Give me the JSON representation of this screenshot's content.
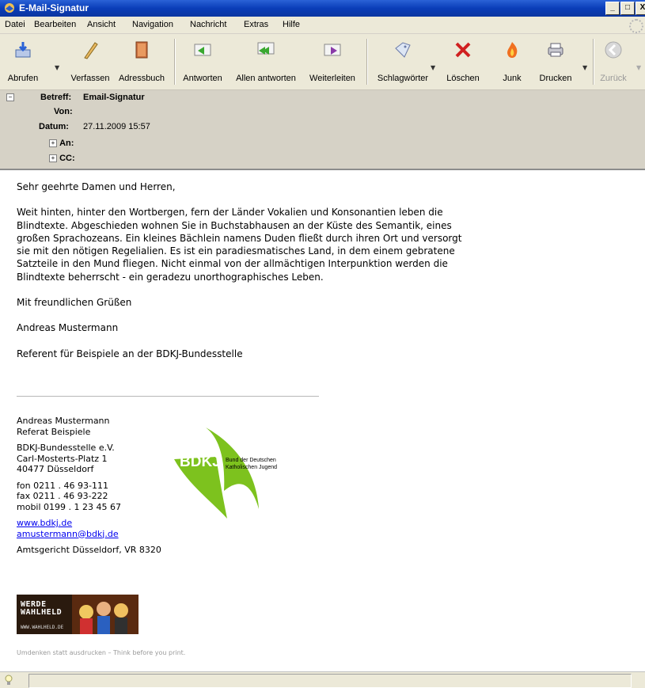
{
  "window": {
    "title": "E-Mail-Signatur",
    "buttons": [
      "_",
      "□",
      "X"
    ]
  },
  "menu": [
    "Datei",
    "Bearbeiten",
    "Ansicht",
    "Navigation",
    "Nachricht",
    "Extras",
    "Hilfe"
  ],
  "toolbar": {
    "abrufen": "Abrufen",
    "verfassen": "Verfassen",
    "adressbuch": "Adressbuch",
    "antworten": "Antworten",
    "allen_antworten": "Allen antworten",
    "weiterleiten": "Weiterleiten",
    "schlagwoerter": "Schlagwörter",
    "loeschen": "Löschen",
    "junk": "Junk",
    "drucken": "Drucken",
    "zurueck": "Zurück"
  },
  "header": {
    "collapse": "−",
    "betreff_label": "Betreff:",
    "betreff_value": "Email-Signatur",
    "von_label": "Von:",
    "von_value": "",
    "datum_label": "Datum:",
    "datum_value": "27.11.2009 15:57",
    "an_label": "An:",
    "cc_label": "CC:",
    "expand": "+"
  },
  "body": {
    "greeting": "Sehr geehrte Damen und Herren,",
    "paragraph": [
      "Weit hinten, hinter den Wortbergen, fern der Länder Vokalien und Konsonantien leben die",
      "Blindtexte. Abgeschieden wohnen Sie in Buchstabhausen an der Küste des Semantik, eines",
      "großen Sprachozeans. Ein kleines Bächlein namens Duden fließt durch ihren Ort und versorgt",
      "sie mit den nötigen Regelialien. Es ist ein paradiesmatisches Land, in dem einem gebratene",
      "Satzteile in den Mund fliegen. Nicht einmal von der allmächtigen Interpunktion werden die",
      "Blindtexte beherrscht - ein geradezu unorthographisches Leben."
    ],
    "closing": "Mit freundlichen Grüßen",
    "name": "Andreas Mustermann",
    "role": "Referent für Beispiele an der BDKJ-Bundesstelle"
  },
  "signature": {
    "name": "Andreas Mustermann",
    "dept": "Referat Beispiele",
    "org": "BDKJ-Bundesstelle e.V.",
    "street": "Carl-Mosterts-Platz 1",
    "city": "40477 Düsseldorf",
    "fon": "fon 0211 . 46 93-111",
    "fax": "fax 0211 . 46 93-222",
    "mobil": "mobil  0199 . 1 23 45 67",
    "web": "www.bdkj.de",
    "email": "amustermann@bdkj.de",
    "court": "Amtsgericht Düsseldorf, VR 8320",
    "logo_text": "BDKJ",
    "logo_sub1": "Bund der Deutschen",
    "logo_sub2": "Katholischen Jugend",
    "banner_line1": "WERDE",
    "banner_line2": "WAHLHELD",
    "banner_url": "WWW.WAHLHELD.DE",
    "footnote": "Umdenken statt ausdrucken – Think before you print."
  },
  "colors": {
    "titlebar": "#0a3db8",
    "chrome": "#ece9d8",
    "header_pane": "#d6d2c6",
    "bdkj_green": "#7dc21e",
    "link": "#0000ee"
  }
}
